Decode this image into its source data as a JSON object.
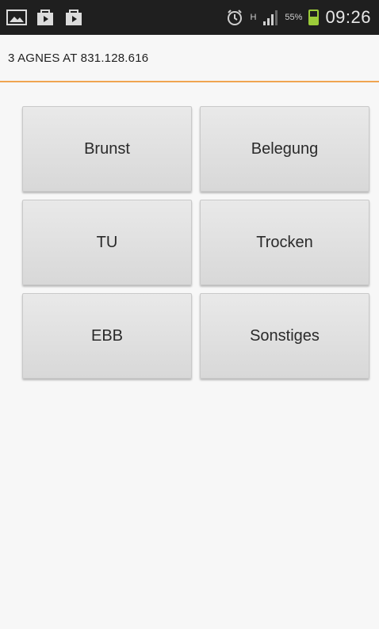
{
  "status_bar": {
    "icons_left": [
      "image-icon",
      "play-store-icon",
      "play-store-icon"
    ],
    "icons_right": [
      "alarm-icon",
      "network-h-icon",
      "signal-icon"
    ],
    "network_type": "H",
    "battery_percent_text": "55%",
    "battery_level": 0.55,
    "battery_color": "#9ccc3a",
    "clock": "09:26"
  },
  "header": {
    "title": "3 AGNES AT 831.128.616",
    "accent_color": "#f0a550"
  },
  "buttons": [
    {
      "label": "Brunst"
    },
    {
      "label": "Belegung"
    },
    {
      "label": "TU"
    },
    {
      "label": "Trocken"
    },
    {
      "label": "EBB"
    },
    {
      "label": "Sonstiges"
    }
  ]
}
